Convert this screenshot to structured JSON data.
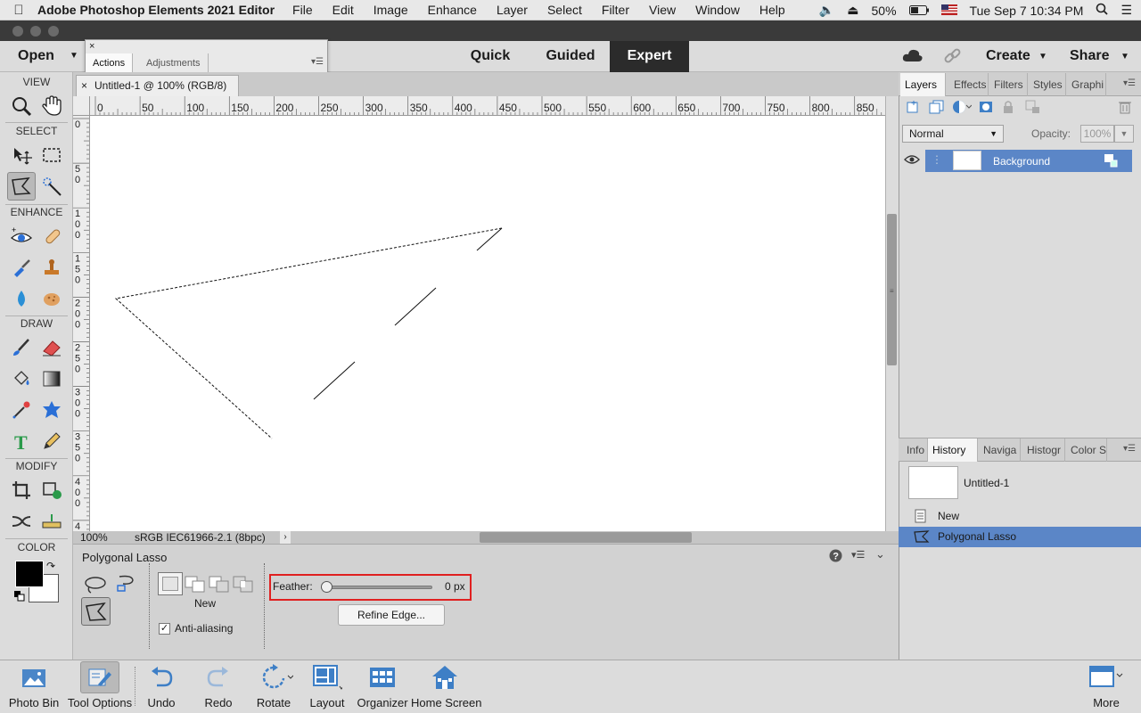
{
  "menubar": {
    "app_name": "Adobe Photoshop Elements 2021 Editor",
    "items": [
      "File",
      "Edit",
      "Image",
      "Enhance",
      "Layer",
      "Select",
      "Filter",
      "View",
      "Window",
      "Help"
    ],
    "battery": "50%",
    "clock": "Tue Sep 7  10:34 PM"
  },
  "modebar": {
    "open_label": "Open",
    "modes": [
      "Quick",
      "Guided",
      "Expert"
    ],
    "active_mode": "Expert",
    "create_label": "Create",
    "share_label": "Share"
  },
  "floating_panel": {
    "tabs": [
      "Actions",
      "Adjustments"
    ],
    "active": "Actions"
  },
  "toolbox": {
    "sections": [
      "VIEW",
      "SELECT",
      "ENHANCE",
      "DRAW",
      "MODIFY",
      "COLOR"
    ],
    "foreground_color": "#000000",
    "background_color": "#ffffff"
  },
  "document": {
    "tab_title": "Untitled-1 @ 100% (RGB/8)",
    "zoom": "100%",
    "color_profile": "sRGB IEC61966-2.1 (8bpc)",
    "ruler_top": [
      "0",
      "50",
      "100",
      "150",
      "200",
      "250",
      "300",
      "350",
      "400",
      "450",
      "500",
      "550",
      "600",
      "650",
      "700",
      "750",
      "800",
      "850"
    ],
    "ruler_left": [
      [
        "0"
      ],
      [
        "5",
        "0"
      ],
      [
        "1",
        "0",
        "0"
      ],
      [
        "1",
        "5",
        "0"
      ],
      [
        "2",
        "0",
        "0"
      ],
      [
        "2",
        "5",
        "0"
      ],
      [
        "3",
        "0",
        "0"
      ],
      [
        "3",
        "5",
        "0"
      ],
      [
        "4",
        "0",
        "0"
      ],
      [
        "4"
      ]
    ]
  },
  "tool_options": {
    "tool_name": "Polygonal Lasso",
    "mode_label": "New",
    "anti_alias_label": "Anti-aliasing",
    "anti_alias_checked": true,
    "feather_label": "Feather:",
    "feather_value": "0 px",
    "feather_fraction": 0,
    "refine_edge_label": "Refine Edge..."
  },
  "layers_panel": {
    "tabs": [
      "Layers",
      "Effects",
      "Filters",
      "Styles",
      "Graphi"
    ],
    "active_tab": "Layers",
    "blend_mode": "Normal",
    "opacity_label": "Opacity:",
    "opacity_value": "100%",
    "layers": [
      {
        "name": "Background"
      }
    ]
  },
  "history_panel": {
    "tabs": [
      "Info",
      "History",
      "Naviga",
      "Histogr",
      "Color S"
    ],
    "active_tab": "History",
    "snapshot": "Untitled-1",
    "states": [
      "New",
      "Polygonal Lasso"
    ]
  },
  "bottombar": {
    "left": [
      "Photo Bin",
      "Tool Options",
      "Undo",
      "Redo",
      "Rotate",
      "Layout",
      "Organizer",
      "Home Screen"
    ],
    "right": "More"
  },
  "colors": {
    "accent_selection": "#5b86c7",
    "highlight_box": "#e02020",
    "expert_tab_bg": "#2b2b2b"
  }
}
